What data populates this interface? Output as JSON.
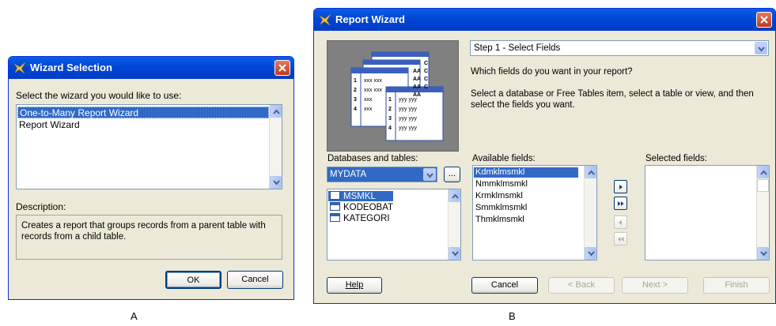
{
  "dialog_a": {
    "title": "Wizard Selection",
    "prompt": "Select the wizard you would like to use:",
    "wizards": [
      {
        "label": "One-to-Many Report Wizard",
        "selected": true
      },
      {
        "label": "Report Wizard",
        "selected": false
      }
    ],
    "description_label": "Description:",
    "description_text": "Creates a report that groups records from a parent table with records from a child table.",
    "ok_label": "OK",
    "cancel_label": "Cancel"
  },
  "dialog_b": {
    "title": "Report Wizard",
    "step_value": "Step 1 - Select Fields",
    "question": "Which fields do you want in your report?",
    "instructions": "Select a database or Free Tables item, select a table or view, and then select the fields you want.",
    "databases_label": "Databases and tables:",
    "database_value": "MYDATA",
    "browse_label": "...",
    "tables": [
      {
        "label": "MSMKL",
        "selected": true
      },
      {
        "label": "KODEOBAT",
        "selected": false
      },
      {
        "label": "KATEGORI",
        "selected": false
      }
    ],
    "available_label": "Available fields:",
    "available_fields": [
      {
        "label": "Kdmklmsmkl",
        "selected": true
      },
      {
        "label": "Nmmklmsmkl",
        "selected": false
      },
      {
        "label": "Krmklmsmkl",
        "selected": false
      },
      {
        "label": "Smmklmsmkl",
        "selected": false
      },
      {
        "label": "Thmklmsmkl",
        "selected": false
      }
    ],
    "selected_label": "Selected fields:",
    "help_label": "Help",
    "cancel_label": "Cancel",
    "back_label": "< Back",
    "next_label": "Next >",
    "finish_label": "Finish",
    "illustration": {
      "rows": [
        {
          "num": "1",
          "text": "xxx xxx"
        },
        {
          "num": "2",
          "text": "xxx xxx"
        },
        {
          "num": "3",
          "text": "xxx"
        },
        {
          "num": "4",
          "text": "xxx"
        }
      ],
      "front_rows": [
        {
          "num": "1",
          "text": "yyy yyy"
        },
        {
          "num": "2",
          "text": "yyy yyy"
        },
        {
          "num": "3",
          "text": "yyy yyy"
        },
        {
          "num": "4",
          "text": "yyy yyy"
        }
      ],
      "mid_labels": [
        "AA",
        "AA",
        "AA",
        "AA"
      ],
      "back_labels": [
        "C",
        "C",
        "C",
        "C"
      ]
    }
  },
  "captions": {
    "a": "A",
    "b": "B"
  },
  "colors": {
    "titlebar": "#0054e3",
    "selection": "#316ac5",
    "dialog_bg": "#ece9d8"
  }
}
